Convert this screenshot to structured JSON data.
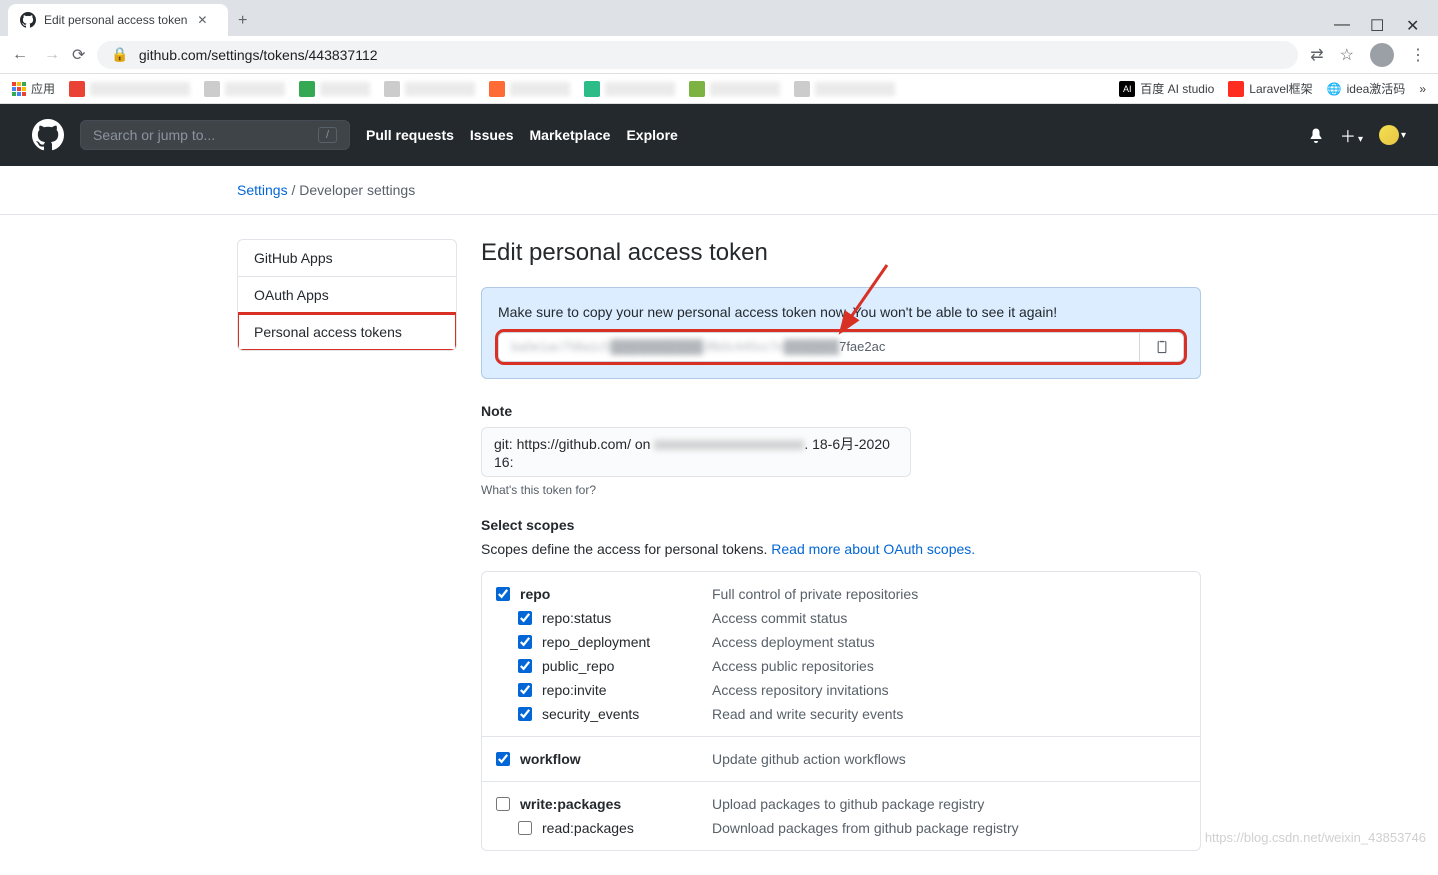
{
  "browser": {
    "tab_title": "Edit personal access token",
    "url": "github.com/settings/tokens/443837112",
    "apps_label": "应用",
    "bookmarks_right": [
      {
        "icon": "ai",
        "label": "百度 AI studio"
      },
      {
        "icon": "laravel",
        "label": "Laravel框架"
      },
      {
        "icon": "globe",
        "label": "idea激活码"
      }
    ]
  },
  "gh": {
    "search_placeholder": "Search or jump to...",
    "nav": [
      "Pull requests",
      "Issues",
      "Marketplace",
      "Explore"
    ]
  },
  "breadcrumb": {
    "settings": "Settings",
    "devsettings": "Developer settings"
  },
  "sidebar": {
    "items": [
      "GitHub Apps",
      "OAuth Apps",
      "Personal access tokens"
    ],
    "selected": 2
  },
  "page": {
    "title": "Edit personal access token",
    "flash_msg": "Make sure to copy your new personal access token now. You won't be able to see it again!",
    "token_visible_suffix": "7fae2ac",
    "note_label": "Note",
    "note_prefix": "git: https://github.com/ on ",
    "note_suffix": ". 18-6月-2020 16:",
    "note_hint": "What's this token for?",
    "scopes_label": "Select scopes",
    "scopes_desc": "Scopes define the access for personal tokens. ",
    "scopes_link": "Read more about OAuth scopes."
  },
  "scopes": [
    {
      "name": "repo",
      "desc": "Full control of private repositories",
      "checked": true,
      "children": [
        {
          "name": "repo:status",
          "desc": "Access commit status",
          "checked": true
        },
        {
          "name": "repo_deployment",
          "desc": "Access deployment status",
          "checked": true
        },
        {
          "name": "public_repo",
          "desc": "Access public repositories",
          "checked": true
        },
        {
          "name": "repo:invite",
          "desc": "Access repository invitations",
          "checked": true
        },
        {
          "name": "security_events",
          "desc": "Read and write security events",
          "checked": true
        }
      ]
    },
    {
      "name": "workflow",
      "desc": "Update github action workflows",
      "checked": true,
      "children": []
    },
    {
      "name": "write:packages",
      "desc": "Upload packages to github package registry",
      "checked": false,
      "children": [
        {
          "name": "read:packages",
          "desc": "Download packages from github package registry",
          "checked": false
        }
      ]
    }
  ],
  "watermark": "https://blog.csdn.net/weixin_43853746"
}
